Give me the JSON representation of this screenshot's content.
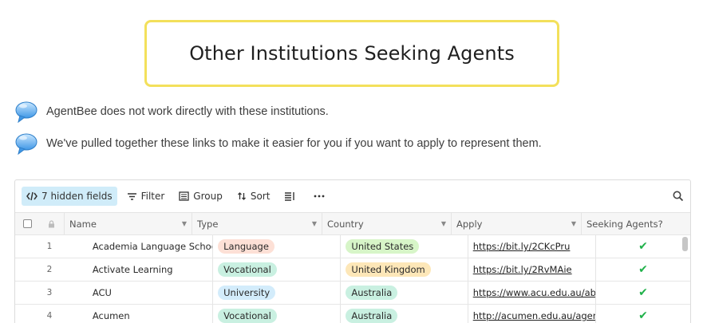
{
  "header": {
    "title": "Other Institutions Seeking Agents"
  },
  "notes": [
    "AgentBee does not work directly with these institutions.",
    "We've pulled together these links to make it easier for you if you want to apply to represent them."
  ],
  "toolbar": {
    "hidden_fields": "7 hidden fields",
    "filter": "Filter",
    "group": "Group",
    "sort": "Sort"
  },
  "columns": {
    "name": "Name",
    "type": "Type",
    "country": "Country",
    "apply": "Apply",
    "seeking": "Seeking Agents?"
  },
  "rows": [
    {
      "num": "1",
      "name": "Academia Language School",
      "type": "Language",
      "country": "United States",
      "apply": "https://bit.ly/2CKcPru",
      "seeking": "✔"
    },
    {
      "num": "2",
      "name": "Activate Learning",
      "type": "Vocational",
      "country": "United Kingdom",
      "apply": "https://bit.ly/2RvMAie",
      "seeking": "✔"
    },
    {
      "num": "3",
      "name": "ACU",
      "type": "University",
      "country": "Australia",
      "apply": "https://www.acu.edu.au/ab...",
      "seeking": "✔"
    },
    {
      "num": "4",
      "name": "Acumen",
      "type": "Vocational",
      "country": "Australia",
      "apply": "http://acumen.edu.au/agen...",
      "seeking": "✔"
    }
  ],
  "pill_colors": {
    "Language": "#fde0d6",
    "Vocational": "#c9f0e1",
    "University": "#d3ecfb",
    "United States": "#d7f5c8",
    "United Kingdom": "#fde7b8",
    "Australia": "#c9f0e1"
  }
}
